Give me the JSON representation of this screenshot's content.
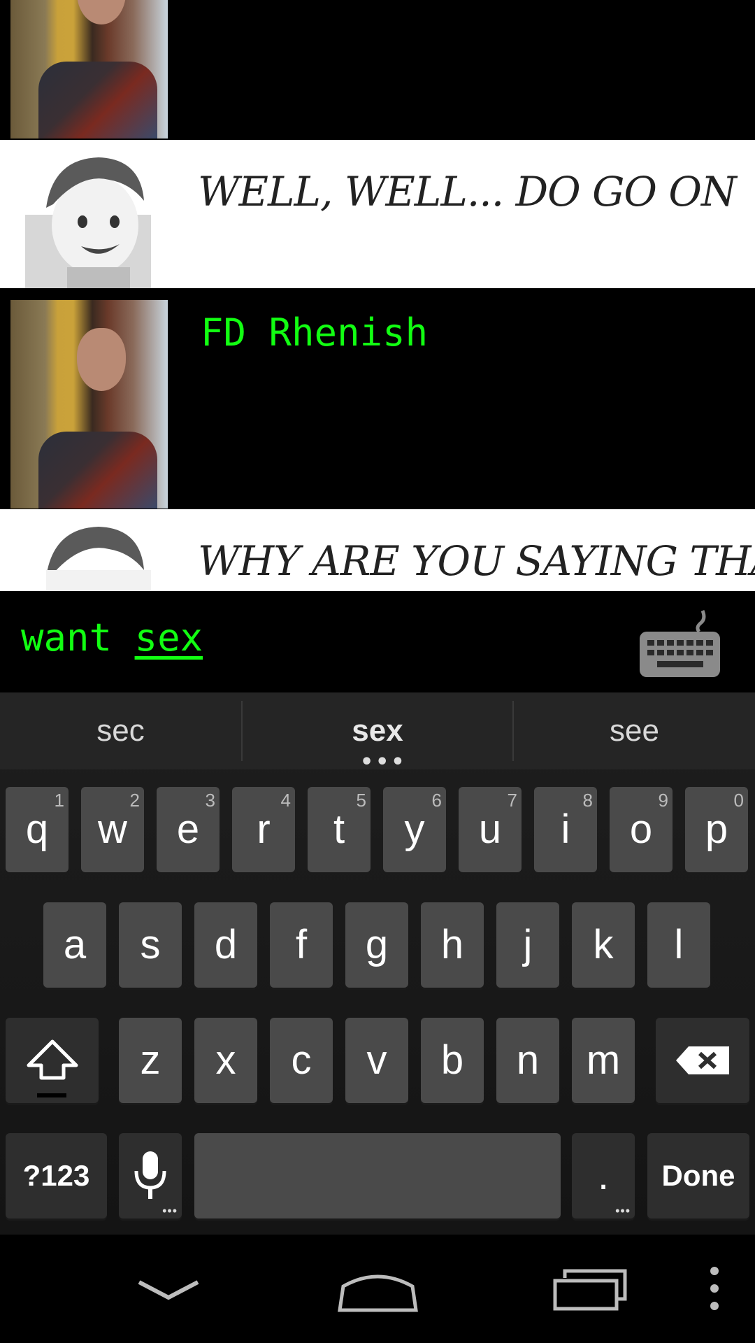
{
  "conversation": {
    "bot_message_1": "WELL, WELL... DO GO ON",
    "user_message_1": "FD Rhenish",
    "bot_message_2": "WHY ARE YOU SAYING THAT?"
  },
  "input": {
    "typed_text": "want ",
    "composing_word": "sex",
    "keyboard_toggle_icon": "keyboard-icon"
  },
  "keyboard": {
    "suggestions": [
      "sec",
      "sex",
      "see"
    ],
    "row1": [
      {
        "label": "q",
        "hint": "1"
      },
      {
        "label": "w",
        "hint": "2"
      },
      {
        "label": "e",
        "hint": "3"
      },
      {
        "label": "r",
        "hint": "4"
      },
      {
        "label": "t",
        "hint": "5"
      },
      {
        "label": "y",
        "hint": "6"
      },
      {
        "label": "u",
        "hint": "7"
      },
      {
        "label": "i",
        "hint": "8"
      },
      {
        "label": "o",
        "hint": "9"
      },
      {
        "label": "p",
        "hint": "0"
      }
    ],
    "row2": [
      "a",
      "s",
      "d",
      "f",
      "g",
      "h",
      "j",
      "k",
      "l"
    ],
    "row3": [
      "z",
      "x",
      "c",
      "v",
      "b",
      "n",
      "m"
    ],
    "symbols_label": "?123",
    "period_label": ".",
    "done_label": "Done",
    "icons": [
      "shift-icon",
      "backspace-icon",
      "microphone-icon"
    ]
  },
  "navigation": {
    "icons": [
      "back-down-icon",
      "home-icon",
      "recent-apps-icon",
      "overflow-menu-icon"
    ]
  },
  "colors": {
    "user_text": "#12ff12",
    "bot_background": "#ffffff",
    "keyboard_key": "#4a4a4a"
  }
}
